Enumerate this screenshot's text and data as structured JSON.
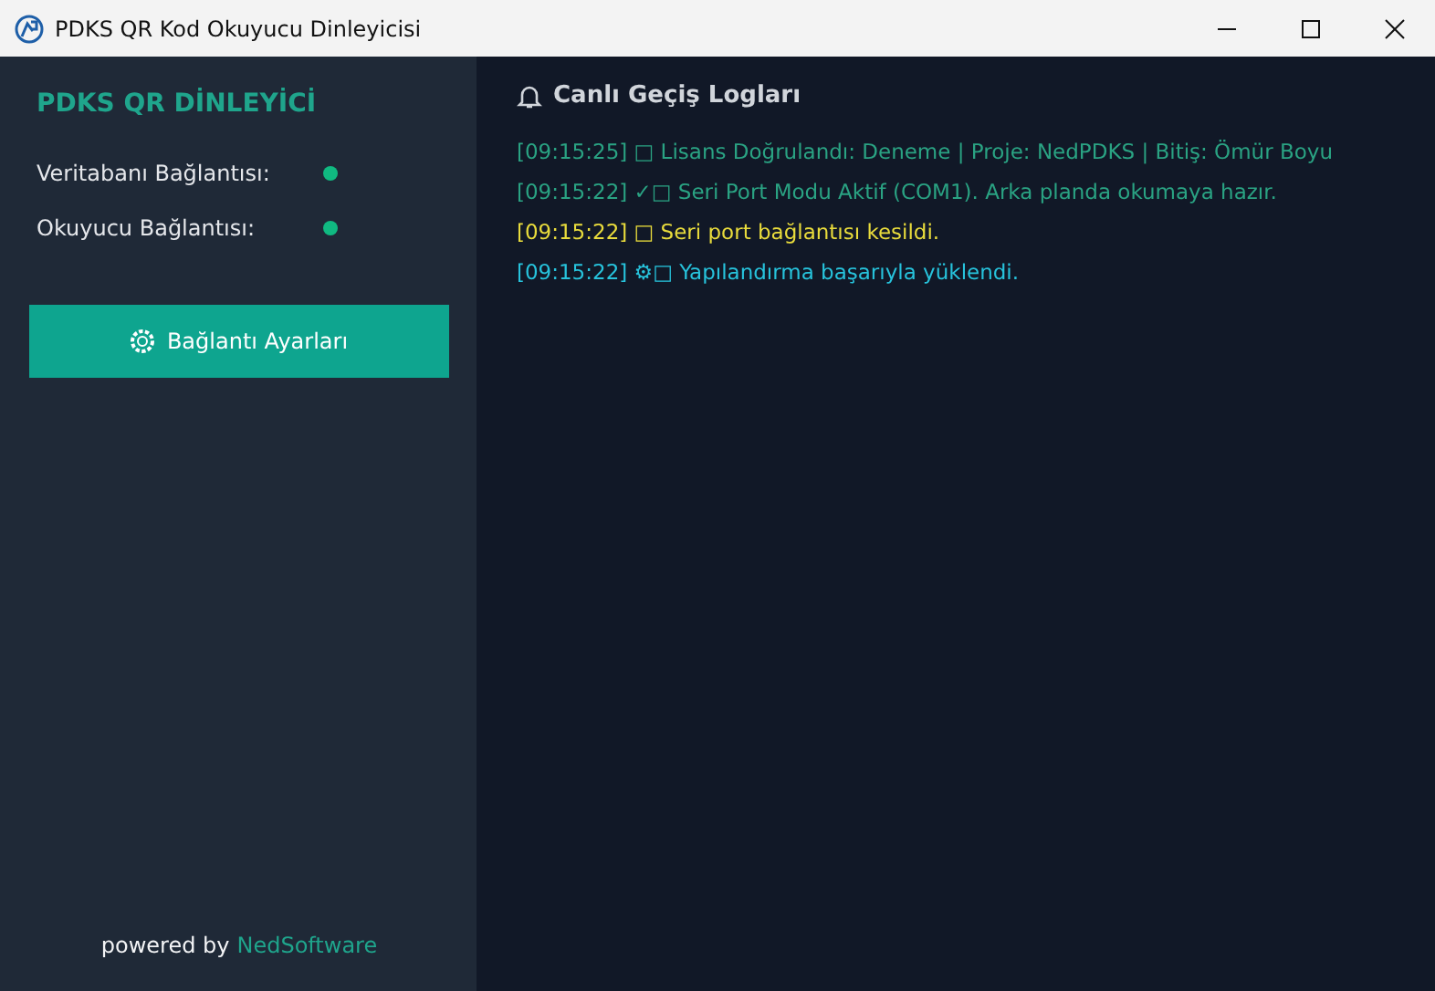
{
  "window": {
    "title": "PDKS QR Kod Okuyucu Dinleyicisi"
  },
  "sidebar": {
    "title": "PDKS QR DİNLEYİCİ",
    "statuses": [
      {
        "label": "Veritabanı Bağlantısı:",
        "connected": true
      },
      {
        "label": "Okuyucu Bağlantısı:",
        "connected": true
      }
    ],
    "settings_button": "Bağlantı Ayarları",
    "footer": {
      "prefix": "powered by",
      "brand": "NedSoftware"
    }
  },
  "log_panel": {
    "title": "Canlı Geçiş Logları",
    "entries": [
      {
        "text": "[09:15:25] □ Lisans Doğrulandı: Deneme | Proje: NedPDKS | Bitiş: Ömür Boyu",
        "color": "#2aa383"
      },
      {
        "text": "[09:15:22] ✓□ Seri Port Modu Aktif (COM1). Arka planda okumaya hazır.",
        "color": "#2aa383"
      },
      {
        "text": "[09:15:22] □ Seri port bağlantısı kesildi.",
        "color": "#e9dc3c"
      },
      {
        "text": "[09:15:22] ⚙□ Yapılandırma başarıyla yüklendi.",
        "color": "#27c3dc"
      }
    ]
  }
}
